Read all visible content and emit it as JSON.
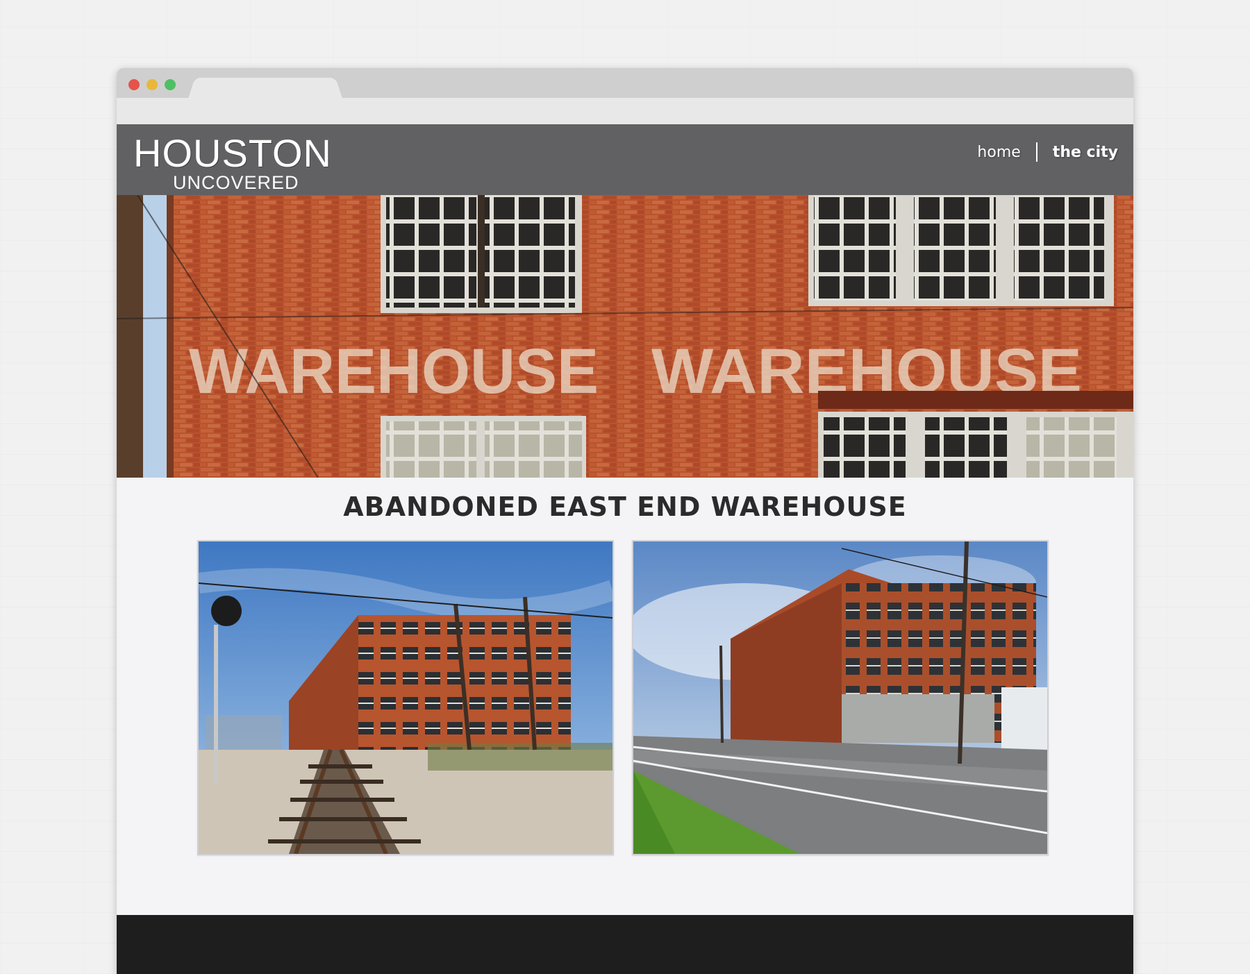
{
  "site": {
    "logo_title": "HOUSTON",
    "logo_subtitle": "UNCOVERED"
  },
  "nav": {
    "items": [
      {
        "label": "home",
        "active": false
      },
      {
        "label": "the city",
        "active": true
      }
    ]
  },
  "hero": {
    "icon": "warehouse-facade-photo",
    "painted_sign_left": "WAREHOUSE",
    "painted_sign_right": "WAREHOUSE"
  },
  "main": {
    "title": "ABANDONED EAST END WAREHOUSE",
    "photos": [
      {
        "icon": "warehouse-rail-tracks-photo"
      },
      {
        "icon": "warehouse-street-view-photo"
      }
    ]
  },
  "colors": {
    "header_bg": "#616163",
    "footer_bg": "#1e1e1f",
    "page_bg": "#f4f4f7",
    "brick": "#b8522f"
  }
}
